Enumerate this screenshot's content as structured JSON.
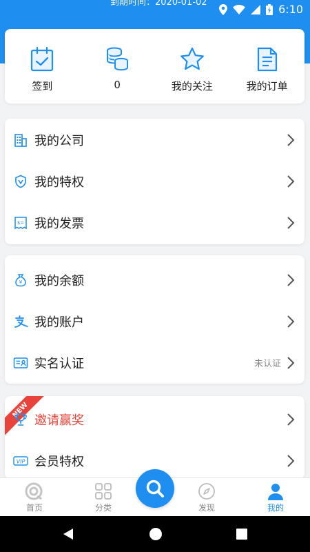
{
  "status_bar": {
    "expire_text": "到期时间：2020-01-02",
    "time": "6:10"
  },
  "quick_actions": [
    {
      "label": "签到",
      "icon": "calendar-check-icon"
    },
    {
      "label": "0",
      "icon": "coins-icon"
    },
    {
      "label": "我的关注",
      "icon": "star-icon"
    },
    {
      "label": "我的订单",
      "icon": "order-document-icon"
    }
  ],
  "menu_group_1": [
    {
      "label": "我的公司",
      "icon": "building-icon"
    },
    {
      "label": "我的特权",
      "icon": "shield-v-icon"
    },
    {
      "label": "我的发票",
      "icon": "invoice-icon"
    }
  ],
  "menu_group_2": [
    {
      "label": "我的余额",
      "icon": "money-bag-icon"
    },
    {
      "label": "我的账户",
      "icon": "alipay-icon"
    },
    {
      "label": "实名认证",
      "icon": "id-card-icon",
      "sub": "未认证"
    }
  ],
  "menu_group_3": [
    {
      "label": "邀请赢奖",
      "icon": "trophy-icon",
      "badge": "NEW"
    },
    {
      "label": "会员特权",
      "icon": "vip-icon"
    }
  ],
  "tabbar": {
    "items": [
      {
        "label": "首页",
        "icon": "home-icon"
      },
      {
        "label": "分类",
        "icon": "category-grid-icon"
      },
      {
        "label": "",
        "icon": "search-icon"
      },
      {
        "label": "发现",
        "icon": "compass-icon"
      },
      {
        "label": "我的",
        "icon": "user-icon",
        "active": true
      }
    ]
  },
  "colors": {
    "accent": "#1e8ef0",
    "alert": "#e8433a",
    "background": "#f2f3f5"
  }
}
